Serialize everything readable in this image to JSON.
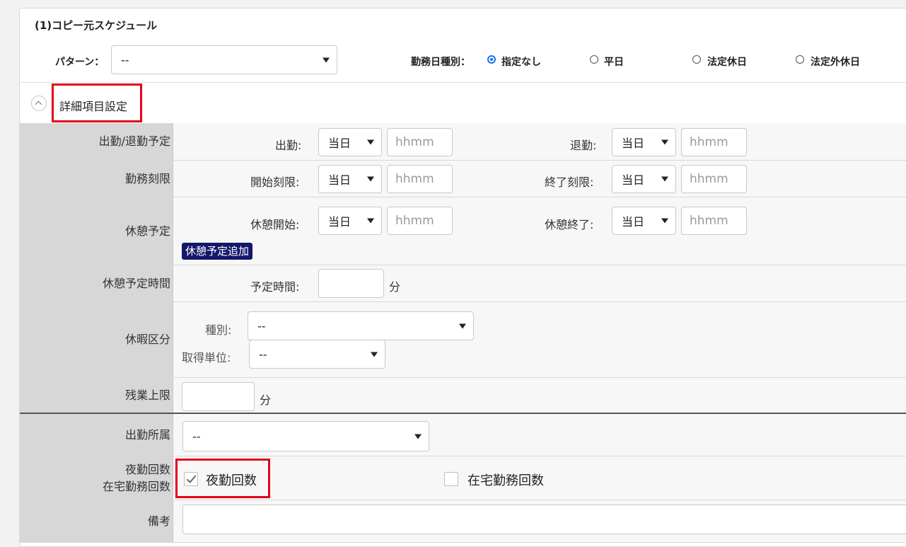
{
  "section": {
    "title": "(1)コピー元スケジュール"
  },
  "pattern": {
    "label": "パターン：",
    "value": "--"
  },
  "workday_type": {
    "label": "勤務日種別：",
    "options": [
      {
        "label": "指定なし",
        "selected": true
      },
      {
        "label": "平日",
        "selected": false
      },
      {
        "label": "法定休日",
        "selected": false
      },
      {
        "label": "法定外休日",
        "selected": false
      }
    ]
  },
  "detail_toggle": {
    "label": "詳細項目設定"
  },
  "rows": {
    "attendance": {
      "label": "出勤/退勤予定",
      "start_label": "出勤:",
      "start_day": "当日",
      "start_placeholder": "hhmm",
      "end_label": "退勤:",
      "end_day": "当日",
      "end_placeholder": "hhmm"
    },
    "limit": {
      "label": "勤務刻限",
      "start_label": "開始刻限:",
      "start_day": "当日",
      "start_placeholder": "hhmm",
      "end_label": "終了刻限:",
      "end_day": "当日",
      "end_placeholder": "hhmm"
    },
    "break": {
      "label": "休憩予定",
      "start_label": "休憩開始:",
      "start_day": "当日",
      "start_placeholder": "hhmm",
      "end_label": "休憩終了:",
      "end_day": "当日",
      "end_placeholder": "hhmm",
      "add_button": "休憩予定追加"
    },
    "break_time": {
      "label": "休憩予定時間",
      "field_label": "予定時間:",
      "unit": "分"
    },
    "leave": {
      "label": "休暇区分",
      "type_label": "種別:",
      "type_value": "--",
      "unit_label": "取得単位:",
      "unit_value": "--"
    },
    "overtime": {
      "label": "残業上限",
      "unit": "分"
    },
    "dept": {
      "label": "出勤所属",
      "value": "--"
    },
    "counts": {
      "label_line1": "夜勤回数",
      "label_line2": "在宅勤務回数",
      "night_label": "夜勤回数",
      "night_checked": true,
      "remote_label": "在宅勤務回数",
      "remote_checked": false
    },
    "notes": {
      "label": "備考"
    }
  }
}
